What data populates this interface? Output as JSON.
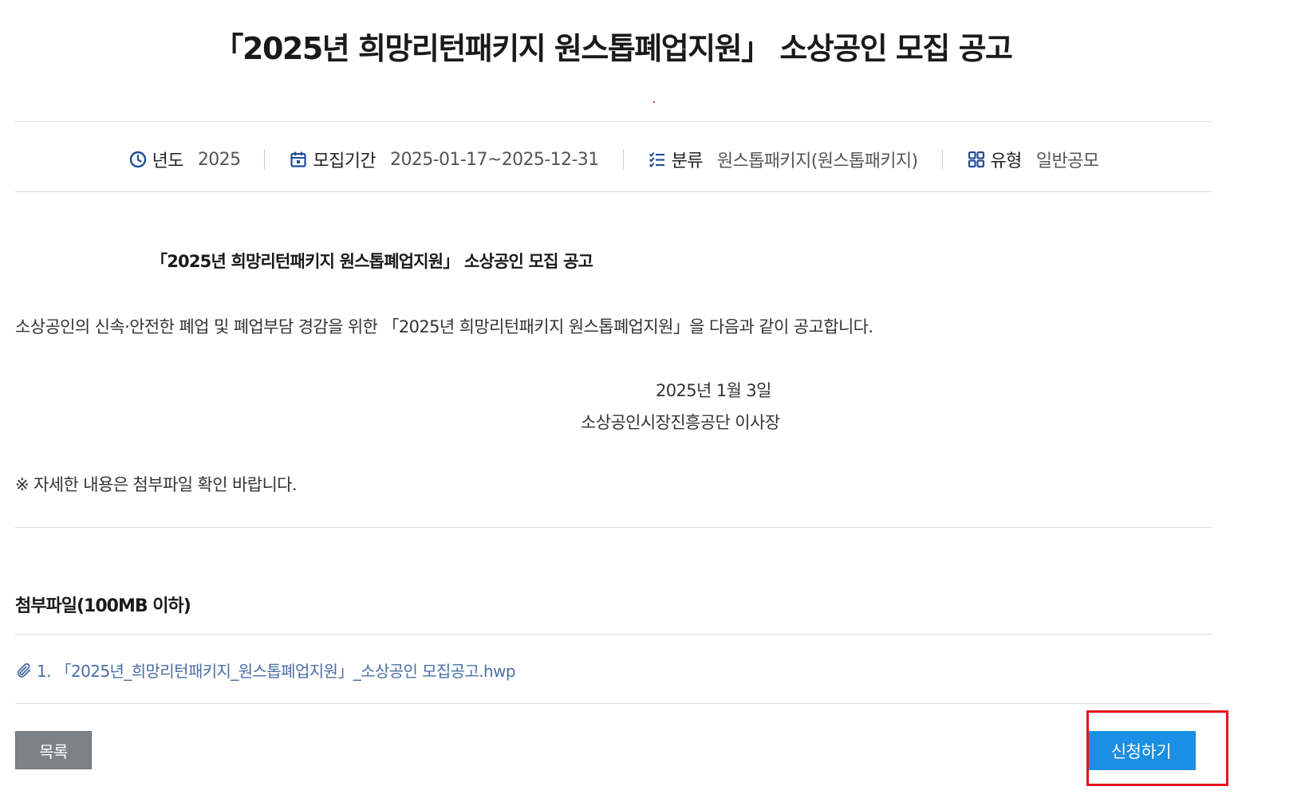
{
  "page": {
    "title": "「2025년 희망리턴패키지 원스톱폐업지원」 소상공인 모집 공고"
  },
  "meta": {
    "year_label": "년도",
    "year_value": "2025",
    "period_label": "모집기간",
    "period_value": "2025-01-17~2025-12-31",
    "category_label": "분류",
    "category_value": "원스톱패키지(원스톱패키지)",
    "type_label": "유형",
    "type_value": "일반공모",
    "icon_color": "#1f4e96"
  },
  "content": {
    "heading": "「2025년 희망리턴패키지 원스톱폐업지원」 소상공인 모집 공고",
    "paragraph": "소상공인의 신속·안전한 폐업 및 폐업부담 경감을 위한 「2025년 희망리턴패키지 원스톱폐업지원」을 다음과 같이 공고합니다.",
    "date": "2025년 1월 3일",
    "issuer": "소상공인시장진흥공단 이사장",
    "note": "※ 자세한 내용은 첨부파일 확인 바랍니다."
  },
  "attachments": {
    "title": "첨부파일(100MB 이하)",
    "files": [
      {
        "name": "1. 「2025년_희망리턴패키지_원스톱폐업지원」_소상공인 모집공고.hwp",
        "icon": "paperclip-icon"
      }
    ]
  },
  "buttons": {
    "list_label": "목록",
    "apply_label": "신청하기"
  },
  "colors": {
    "apply_button": "#1a8fe3",
    "list_button": "#7d8288",
    "highlight": "#e8141c",
    "link": "#4a6fa5"
  }
}
